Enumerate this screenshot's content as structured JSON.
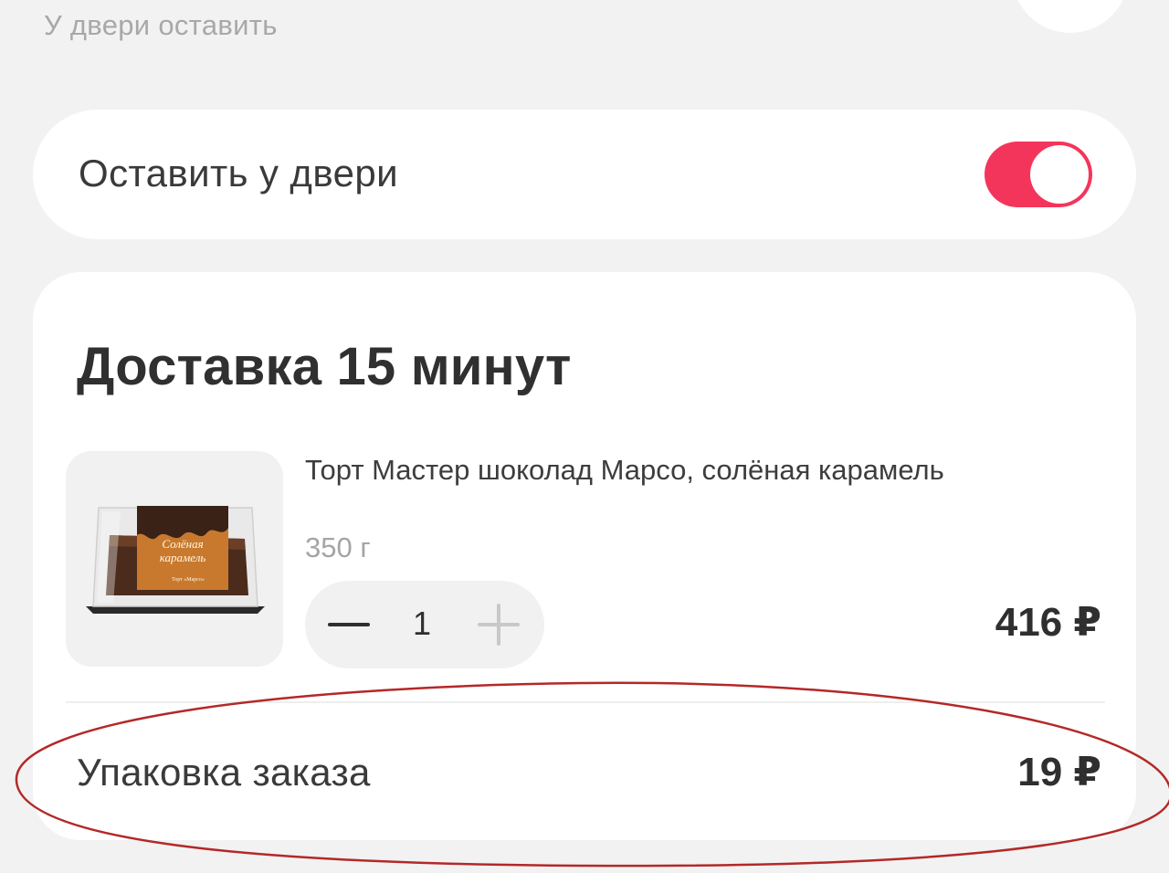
{
  "top_hint": "У двери оставить",
  "leave_at_door": {
    "label": "Оставить у двери",
    "enabled": true,
    "accent_color": "#f4355b"
  },
  "delivery": {
    "title": "Доставка 15 минут"
  },
  "product": {
    "name": "Торт Мастер шоколад Марсо, солёная карамель",
    "weight": "350 г",
    "quantity": "1",
    "price": "416 ₽",
    "image_label_line1": "Солёная",
    "image_label_line2": "карамель",
    "image_brand": "Торт «Марсо»"
  },
  "packaging": {
    "label": "Упаковка заказа",
    "price": "19 ₽"
  },
  "annotation_color": "#b42828"
}
